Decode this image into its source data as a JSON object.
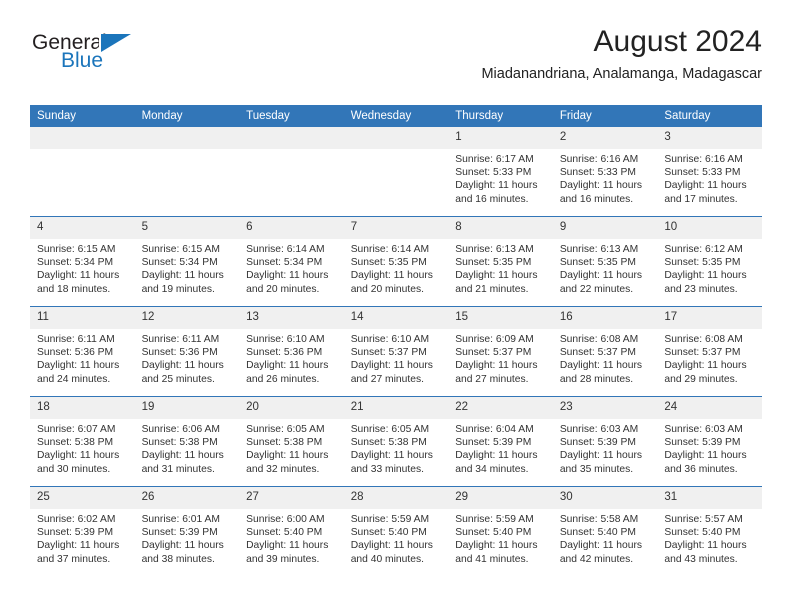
{
  "brand": {
    "name_part1": "General",
    "name_part2": "Blue",
    "logo_icon": "general-blue-flag-logo",
    "accent_color": "#1b75bb"
  },
  "header": {
    "month_title": "August 2024",
    "location": "Miadanandriana, Analamanga, Madagascar"
  },
  "theme": {
    "header_blue": "#3276b8",
    "daynum_band": "#f0f0f0",
    "text": "#333333"
  },
  "calendar": {
    "weekday_headers": [
      "Sunday",
      "Monday",
      "Tuesday",
      "Wednesday",
      "Thursday",
      "Friday",
      "Saturday"
    ],
    "weeks": [
      [
        {
          "day": "",
          "empty": true
        },
        {
          "day": "",
          "empty": true
        },
        {
          "day": "",
          "empty": true
        },
        {
          "day": "",
          "empty": true
        },
        {
          "day": "1",
          "sunrise": "Sunrise: 6:17 AM",
          "sunset": "Sunset: 5:33 PM",
          "daylight_line1": "Daylight: 11 hours",
          "daylight_line2": "and 16 minutes."
        },
        {
          "day": "2",
          "sunrise": "Sunrise: 6:16 AM",
          "sunset": "Sunset: 5:33 PM",
          "daylight_line1": "Daylight: 11 hours",
          "daylight_line2": "and 16 minutes."
        },
        {
          "day": "3",
          "sunrise": "Sunrise: 6:16 AM",
          "sunset": "Sunset: 5:33 PM",
          "daylight_line1": "Daylight: 11 hours",
          "daylight_line2": "and 17 minutes."
        }
      ],
      [
        {
          "day": "4",
          "sunrise": "Sunrise: 6:15 AM",
          "sunset": "Sunset: 5:34 PM",
          "daylight_line1": "Daylight: 11 hours",
          "daylight_line2": "and 18 minutes."
        },
        {
          "day": "5",
          "sunrise": "Sunrise: 6:15 AM",
          "sunset": "Sunset: 5:34 PM",
          "daylight_line1": "Daylight: 11 hours",
          "daylight_line2": "and 19 minutes."
        },
        {
          "day": "6",
          "sunrise": "Sunrise: 6:14 AM",
          "sunset": "Sunset: 5:34 PM",
          "daylight_line1": "Daylight: 11 hours",
          "daylight_line2": "and 20 minutes."
        },
        {
          "day": "7",
          "sunrise": "Sunrise: 6:14 AM",
          "sunset": "Sunset: 5:35 PM",
          "daylight_line1": "Daylight: 11 hours",
          "daylight_line2": "and 20 minutes."
        },
        {
          "day": "8",
          "sunrise": "Sunrise: 6:13 AM",
          "sunset": "Sunset: 5:35 PM",
          "daylight_line1": "Daylight: 11 hours",
          "daylight_line2": "and 21 minutes."
        },
        {
          "day": "9",
          "sunrise": "Sunrise: 6:13 AM",
          "sunset": "Sunset: 5:35 PM",
          "daylight_line1": "Daylight: 11 hours",
          "daylight_line2": "and 22 minutes."
        },
        {
          "day": "10",
          "sunrise": "Sunrise: 6:12 AM",
          "sunset": "Sunset: 5:35 PM",
          "daylight_line1": "Daylight: 11 hours",
          "daylight_line2": "and 23 minutes."
        }
      ],
      [
        {
          "day": "11",
          "sunrise": "Sunrise: 6:11 AM",
          "sunset": "Sunset: 5:36 PM",
          "daylight_line1": "Daylight: 11 hours",
          "daylight_line2": "and 24 minutes."
        },
        {
          "day": "12",
          "sunrise": "Sunrise: 6:11 AM",
          "sunset": "Sunset: 5:36 PM",
          "daylight_line1": "Daylight: 11 hours",
          "daylight_line2": "and 25 minutes."
        },
        {
          "day": "13",
          "sunrise": "Sunrise: 6:10 AM",
          "sunset": "Sunset: 5:36 PM",
          "daylight_line1": "Daylight: 11 hours",
          "daylight_line2": "and 26 minutes."
        },
        {
          "day": "14",
          "sunrise": "Sunrise: 6:10 AM",
          "sunset": "Sunset: 5:37 PM",
          "daylight_line1": "Daylight: 11 hours",
          "daylight_line2": "and 27 minutes."
        },
        {
          "day": "15",
          "sunrise": "Sunrise: 6:09 AM",
          "sunset": "Sunset: 5:37 PM",
          "daylight_line1": "Daylight: 11 hours",
          "daylight_line2": "and 27 minutes."
        },
        {
          "day": "16",
          "sunrise": "Sunrise: 6:08 AM",
          "sunset": "Sunset: 5:37 PM",
          "daylight_line1": "Daylight: 11 hours",
          "daylight_line2": "and 28 minutes."
        },
        {
          "day": "17",
          "sunrise": "Sunrise: 6:08 AM",
          "sunset": "Sunset: 5:37 PM",
          "daylight_line1": "Daylight: 11 hours",
          "daylight_line2": "and 29 minutes."
        }
      ],
      [
        {
          "day": "18",
          "sunrise": "Sunrise: 6:07 AM",
          "sunset": "Sunset: 5:38 PM",
          "daylight_line1": "Daylight: 11 hours",
          "daylight_line2": "and 30 minutes."
        },
        {
          "day": "19",
          "sunrise": "Sunrise: 6:06 AM",
          "sunset": "Sunset: 5:38 PM",
          "daylight_line1": "Daylight: 11 hours",
          "daylight_line2": "and 31 minutes."
        },
        {
          "day": "20",
          "sunrise": "Sunrise: 6:05 AM",
          "sunset": "Sunset: 5:38 PM",
          "daylight_line1": "Daylight: 11 hours",
          "daylight_line2": "and 32 minutes."
        },
        {
          "day": "21",
          "sunrise": "Sunrise: 6:05 AM",
          "sunset": "Sunset: 5:38 PM",
          "daylight_line1": "Daylight: 11 hours",
          "daylight_line2": "and 33 minutes."
        },
        {
          "day": "22",
          "sunrise": "Sunrise: 6:04 AM",
          "sunset": "Sunset: 5:39 PM",
          "daylight_line1": "Daylight: 11 hours",
          "daylight_line2": "and 34 minutes."
        },
        {
          "day": "23",
          "sunrise": "Sunrise: 6:03 AM",
          "sunset": "Sunset: 5:39 PM",
          "daylight_line1": "Daylight: 11 hours",
          "daylight_line2": "and 35 minutes."
        },
        {
          "day": "24",
          "sunrise": "Sunrise: 6:03 AM",
          "sunset": "Sunset: 5:39 PM",
          "daylight_line1": "Daylight: 11 hours",
          "daylight_line2": "and 36 minutes."
        }
      ],
      [
        {
          "day": "25",
          "sunrise": "Sunrise: 6:02 AM",
          "sunset": "Sunset: 5:39 PM",
          "daylight_line1": "Daylight: 11 hours",
          "daylight_line2": "and 37 minutes."
        },
        {
          "day": "26",
          "sunrise": "Sunrise: 6:01 AM",
          "sunset": "Sunset: 5:39 PM",
          "daylight_line1": "Daylight: 11 hours",
          "daylight_line2": "and 38 minutes."
        },
        {
          "day": "27",
          "sunrise": "Sunrise: 6:00 AM",
          "sunset": "Sunset: 5:40 PM",
          "daylight_line1": "Daylight: 11 hours",
          "daylight_line2": "and 39 minutes."
        },
        {
          "day": "28",
          "sunrise": "Sunrise: 5:59 AM",
          "sunset": "Sunset: 5:40 PM",
          "daylight_line1": "Daylight: 11 hours",
          "daylight_line2": "and 40 minutes."
        },
        {
          "day": "29",
          "sunrise": "Sunrise: 5:59 AM",
          "sunset": "Sunset: 5:40 PM",
          "daylight_line1": "Daylight: 11 hours",
          "daylight_line2": "and 41 minutes."
        },
        {
          "day": "30",
          "sunrise": "Sunrise: 5:58 AM",
          "sunset": "Sunset: 5:40 PM",
          "daylight_line1": "Daylight: 11 hours",
          "daylight_line2": "and 42 minutes."
        },
        {
          "day": "31",
          "sunrise": "Sunrise: 5:57 AM",
          "sunset": "Sunset: 5:40 PM",
          "daylight_line1": "Daylight: 11 hours",
          "daylight_line2": "and 43 minutes."
        }
      ]
    ]
  }
}
